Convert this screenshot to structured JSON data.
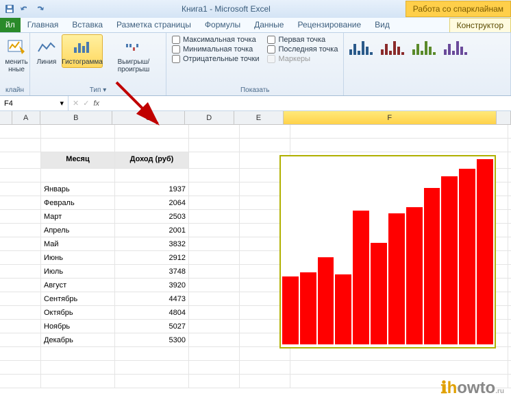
{
  "title": "Книга1 - Microsoft Excel",
  "context_tab": "Работа со спарклайнам",
  "tabs": {
    "file": "йл",
    "home": "Главная",
    "insert": "Вставка",
    "layout": "Разметка страницы",
    "formulas": "Формулы",
    "data": "Данные",
    "review": "Рецензирование",
    "view": "Вид",
    "design": "Конструктор"
  },
  "ribbon": {
    "group1": {
      "label": "клайн",
      "btn": "менить нные"
    },
    "group2": {
      "label": "Тип",
      "line": "Линия",
      "hist": "Гистограмма",
      "winloss": "Выигрыш/проигрыш"
    },
    "group3": {
      "label": "Показать",
      "max": "Максимальная точка",
      "min": "Минимальная точка",
      "neg": "Отрицательные точки",
      "first": "Первая точка",
      "last": "Последняя точка",
      "markers": "Маркеры"
    }
  },
  "namebox": "F4",
  "cols": {
    "A": "A",
    "B": "B",
    "C": "C",
    "D": "D",
    "E": "E",
    "F": "F"
  },
  "headers": {
    "month": "Месяц",
    "income": "Доход (руб)"
  },
  "rows": [
    {
      "m": "Январь",
      "v": "1937"
    },
    {
      "m": "Февраль",
      "v": "2064"
    },
    {
      "m": "Март",
      "v": "2503"
    },
    {
      "m": "Апрель",
      "v": "2001"
    },
    {
      "m": "Май",
      "v": "3832"
    },
    {
      "m": "Июнь",
      "v": "2912"
    },
    {
      "m": "Июль",
      "v": "3748"
    },
    {
      "m": "Август",
      "v": "3920"
    },
    {
      "m": "Сентябрь",
      "v": "4473"
    },
    {
      "m": "Октябрь",
      "v": "4804"
    },
    {
      "m": "Ноябрь",
      "v": "5027"
    },
    {
      "m": "Декабрь",
      "v": "5300"
    }
  ],
  "chart_data": {
    "type": "bar",
    "categories": [
      "Январь",
      "Февраль",
      "Март",
      "Апрель",
      "Май",
      "Июнь",
      "Июль",
      "Август",
      "Сентябрь",
      "Октябрь",
      "Ноябрь",
      "Декабрь"
    ],
    "values": [
      1937,
      2064,
      2503,
      2001,
      3832,
      2912,
      3748,
      3920,
      4473,
      4804,
      5027,
      5300
    ],
    "title": "",
    "xlabel": "",
    "ylabel": "",
    "ylim": [
      0,
      5300
    ]
  },
  "watermark": "howto"
}
